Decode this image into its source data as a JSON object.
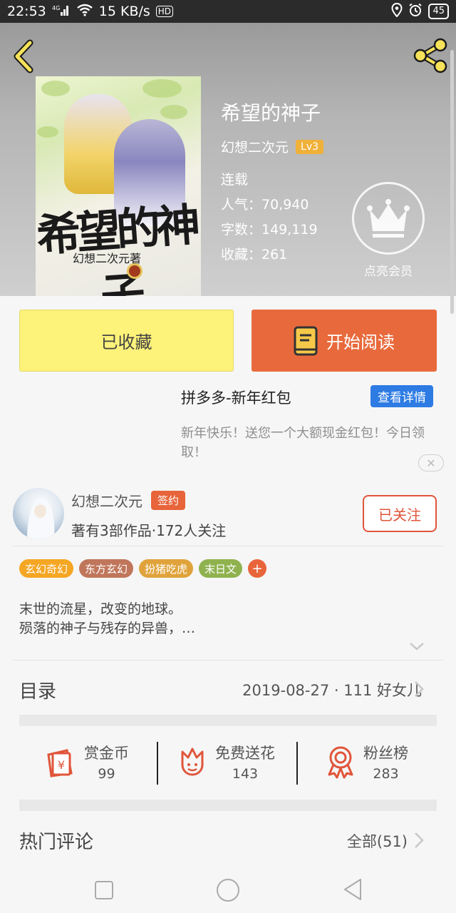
{
  "status_bar": {
    "time": "22:53",
    "signal": "4G",
    "speed": "15 KB/s",
    "hd": "HD",
    "battery": "45"
  },
  "book": {
    "title": "希望的神子",
    "author": "幻想二次元",
    "author_level": "Lv3",
    "status": "连载",
    "popularity": "人气：70,940",
    "word_count": "字数：149,119",
    "favorites": "收藏：261",
    "vip_label": "点亮会员",
    "cover_title_art": "希望的神子",
    "cover_author_art": "幻想二次元著"
  },
  "actions": {
    "collect_label": "已收藏",
    "read_label": "开始阅读"
  },
  "ad": {
    "title": "拼多多-新年红包",
    "button": "查看详情",
    "text": "新年快乐！送您一个大额现金红包！今日领取！",
    "close": "✕"
  },
  "author": {
    "name": "幻想二次元",
    "badge": "签约",
    "info": "著有3部作品·172人关注",
    "follow_label": "已关注"
  },
  "tags": [
    {
      "label": "玄幻奇幻",
      "color": "#f5a623"
    },
    {
      "label": "东方玄幻",
      "color": "#c0765b"
    },
    {
      "label": "扮猪吃虎",
      "color": "#e0a33b"
    },
    {
      "label": "末日文",
      "color": "#8fb24f"
    }
  ],
  "tag_add": "+",
  "description": {
    "line1": "末世的流星，改变的地球。",
    "line2": "殒落的神子与残存的异兽，…"
  },
  "toc": {
    "label": "目录",
    "latest": "2019-08-27 · 111 好女儿"
  },
  "stats": [
    {
      "label": "赏金币",
      "value": "99",
      "icon": "red-envelope-icon"
    },
    {
      "label": "免费送花",
      "value": "143",
      "icon": "flower-icon"
    },
    {
      "label": "粉丝榜",
      "value": "283",
      "icon": "medal-icon"
    }
  ],
  "comments": {
    "label": "热门评论",
    "all": "全部(51)"
  },
  "colors": {
    "accent_orange": "#e86a3c",
    "collect_yellow": "#fdf27a",
    "ad_blue": "#2d7be3",
    "icon_red": "#e0553a",
    "header_gray": "#b5b5b5"
  }
}
